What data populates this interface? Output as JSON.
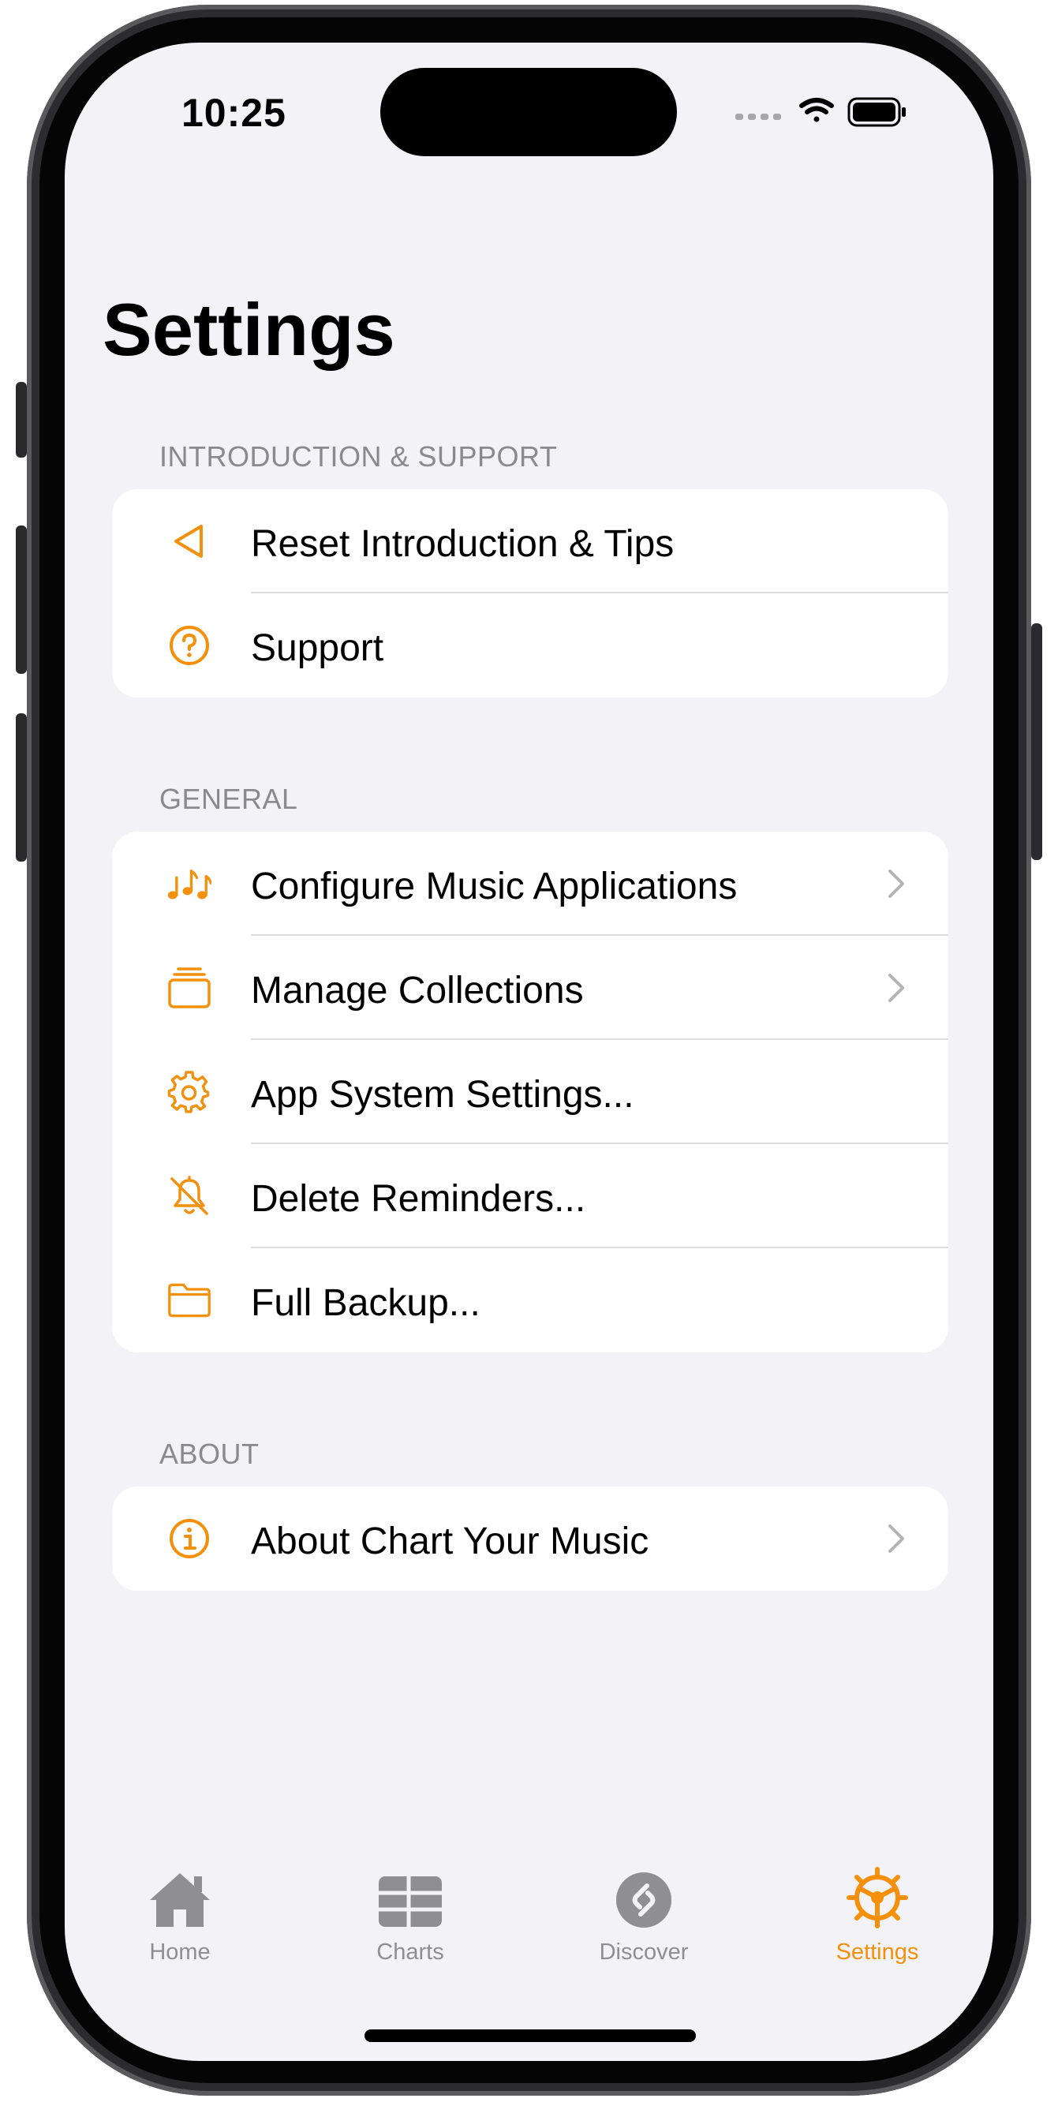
{
  "status_bar": {
    "time": "10:25"
  },
  "page_title": "Settings",
  "accent_color": "#f4900c",
  "sections": [
    {
      "header": "INTRODUCTION & SUPPORT",
      "items": [
        {
          "label": "Reset Introduction & Tips",
          "icon": "reset-triangle-icon"
        },
        {
          "label": "Support",
          "icon": "question-circle-icon"
        }
      ]
    },
    {
      "header": "GENERAL",
      "items": [
        {
          "label": "Configure Music Applications",
          "icon": "music-notes-icon",
          "chevron": true
        },
        {
          "label": "Manage Collections",
          "icon": "collections-stack-icon",
          "chevron": true
        },
        {
          "label": "App System Settings...",
          "icon": "gear-icon"
        },
        {
          "label": "Delete Reminders...",
          "icon": "bell-slash-icon"
        },
        {
          "label": "Full Backup...",
          "icon": "folder-icon"
        }
      ]
    },
    {
      "header": "ABOUT",
      "items": [
        {
          "label": "About Chart Your Music",
          "icon": "info-circle-icon",
          "chevron": true
        }
      ]
    }
  ],
  "tabs": [
    {
      "label": "Home",
      "icon": "house-icon"
    },
    {
      "label": "Charts",
      "icon": "grid-icon"
    },
    {
      "label": "Discover",
      "icon": "shazam-icon"
    },
    {
      "label": "Settings",
      "icon": "settings-wheel-icon",
      "active": true
    }
  ]
}
